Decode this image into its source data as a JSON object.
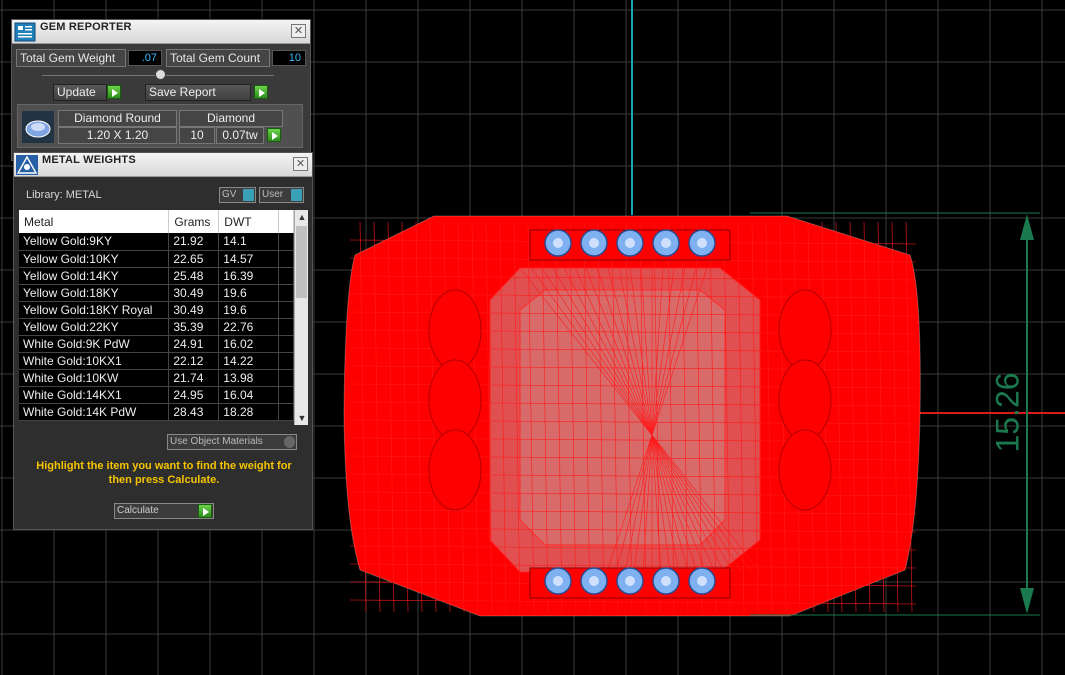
{
  "gem_reporter": {
    "title": "GEM REPORTER",
    "total_weight_label": "Total Gem Weight",
    "total_weight_value": ".07",
    "total_count_label": "Total Gem Count",
    "total_count_value": "10",
    "update_label": "Update",
    "save_report_label": "Save Report",
    "gem": {
      "shape": "Diamond Round",
      "size": "1.20 X 1.20",
      "material": "Diamond",
      "count": "10",
      "weight": "0.07tw"
    }
  },
  "metal_weights": {
    "title": "METAL WEIGHTS",
    "library_label": "Library: METAL",
    "toggle_gv": "GV",
    "toggle_user": "User",
    "columns": [
      "Metal",
      "Grams",
      "DWT"
    ],
    "rows": [
      {
        "metal": "Yellow Gold:9KY",
        "grams": "21.92",
        "dwt": "14.1"
      },
      {
        "metal": "Yellow Gold:10KY",
        "grams": "22.65",
        "dwt": "14.57"
      },
      {
        "metal": "Yellow Gold:14KY",
        "grams": "25.48",
        "dwt": "16.39"
      },
      {
        "metal": "Yellow Gold:18KY",
        "grams": "30.49",
        "dwt": "19.6"
      },
      {
        "metal": "Yellow Gold:18KY Royal",
        "grams": "30.49",
        "dwt": "19.6"
      },
      {
        "metal": "Yellow Gold:22KY",
        "grams": "35.39",
        "dwt": "22.76"
      },
      {
        "metal": "White Gold:9K PdW",
        "grams": "24.91",
        "dwt": "16.02"
      },
      {
        "metal": "White Gold:10KX1",
        "grams": "22.12",
        "dwt": "14.22"
      },
      {
        "metal": "White Gold:10KW",
        "grams": "21.74",
        "dwt": "13.98"
      },
      {
        "metal": "White Gold:14KX1",
        "grams": "24.95",
        "dwt": "16.04"
      },
      {
        "metal": "White Gold:14K PdW",
        "grams": "28.43",
        "dwt": "18.28"
      }
    ],
    "use_object_materials": "Use Object Materials",
    "hint": "Highlight the item you want to find the weight for then press Calculate.",
    "calculate_label": "Calculate"
  },
  "viewport": {
    "dimension_label": "15.26"
  },
  "colors": {
    "ring": "#ff0000",
    "gems": "#7fb0f0",
    "dimension": "#1a7a4e",
    "hint": "#f5c400",
    "value": "#38b8ff"
  }
}
